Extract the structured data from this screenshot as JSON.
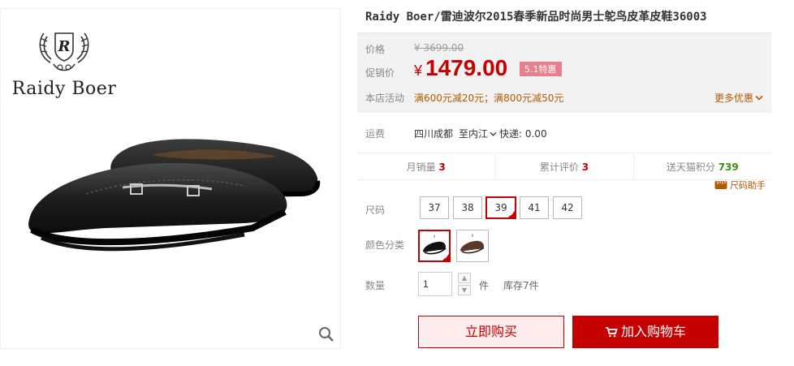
{
  "brand": {
    "name": "Raidy Boer",
    "logo_letter": "R"
  },
  "product": {
    "title": "Raidy Boer/雷迪波尔2015春季新品时尚男士鸵鸟皮革皮鞋36003"
  },
  "price": {
    "label": "价格",
    "original": "¥ 3699.00",
    "promo_label": "促销价",
    "promo_currency": "¥",
    "promo_value": "1479.00",
    "promo_badge": "5.1特惠",
    "activity_label": "本店活动",
    "activity_text": "满600元减20元；满800元减50元",
    "more_label": "更多优惠"
  },
  "shipping": {
    "label": "运费",
    "from": "四川成都",
    "to": "至内江",
    "fee": "快递: 0.00"
  },
  "stats": {
    "monthly_sales_label": "月销量",
    "monthly_sales": "3",
    "reviews_label": "累计评价",
    "reviews": "3",
    "points_label": "送天猫积分",
    "points": "739",
    "size_helper": "尺码助手"
  },
  "options": {
    "size_label": "尺码",
    "sizes": [
      "37",
      "38",
      "39",
      "41",
      "42"
    ],
    "selected_size": "39",
    "color_label": "颜色分类",
    "quantity_label": "数量",
    "quantity_value": "1",
    "quantity_unit": "件",
    "stock_text": "库存7件"
  },
  "actions": {
    "buy_now": "立即购买",
    "add_to_cart": "加入购物车"
  },
  "colors": {
    "accent": "#c40000",
    "promo_badge": "#e87f8e",
    "activity_text": "#b25a00",
    "points": "#3e8e16"
  }
}
